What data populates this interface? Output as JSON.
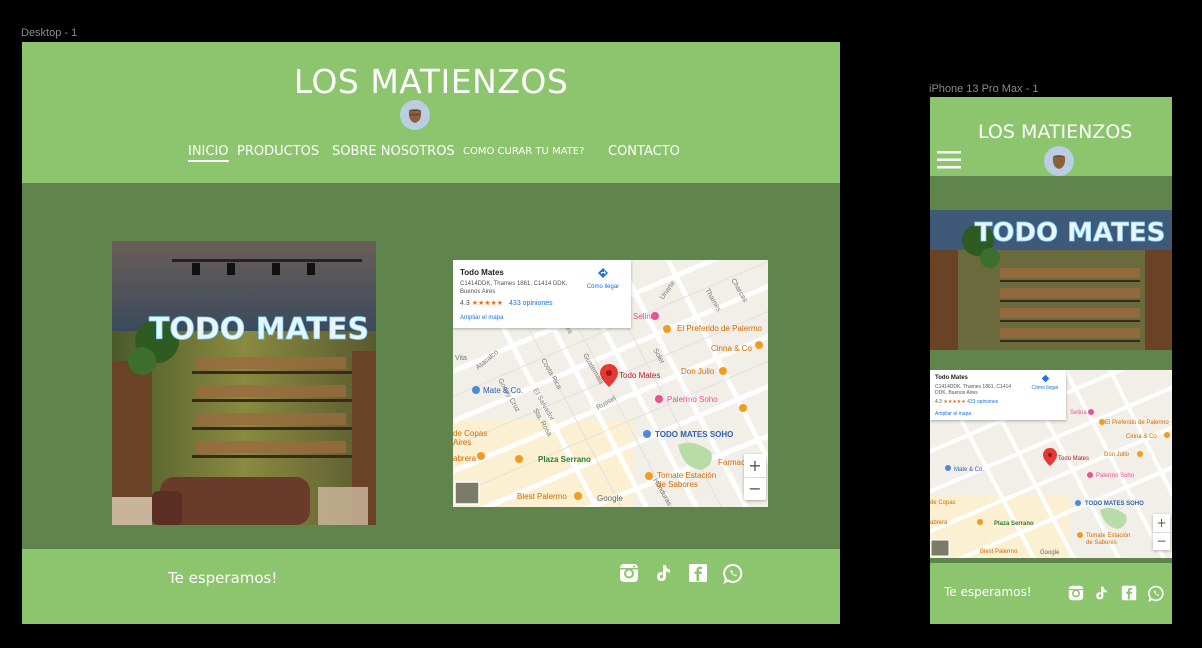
{
  "frames": {
    "desktop_label": "Desktop - 1",
    "mobile_label": "iPhone 13 Pro Max - 1"
  },
  "site": {
    "title": "LOS MATIENZOS",
    "nav": [
      {
        "label": "INICIO",
        "active": true
      },
      {
        "label": "PRODUCTOS",
        "active": false
      },
      {
        "label": "SOBRE NOSOTROS",
        "active": false
      },
      {
        "label": "COMO CURAR TU MATE?",
        "active": false
      },
      {
        "label": "CONTACTO",
        "active": false
      }
    ],
    "store_sign": "TODO MATES",
    "footer_text": "Te esperamos!",
    "social_icons": [
      "instagram-icon",
      "tiktok-icon",
      "facebook-icon",
      "whatsapp-icon"
    ]
  },
  "map": {
    "place_name": "Todo Mates",
    "address": "C1414DDK, Thames 1861, C1414 DDK, Buenos Aires",
    "rating": "4.3",
    "stars": "★★★★★",
    "reviews": "433 opiniones",
    "directions": "Cómo llegar",
    "enlarge": "Ampliar el mapa",
    "zoom_in": "+",
    "zoom_out": "−",
    "brand": "Google",
    "pois": [
      "Selina",
      "El Preferido de Palermo",
      "Cinna & Co",
      "Todo Mates",
      "Don Julio",
      "Mate & Co.",
      "Palermo Soho",
      "TODO MATES SOHO",
      "Plaza Serrano",
      "Farmac",
      "Tomate Estación de Sabores",
      "Blest Palermo",
      "de Copas Aires",
      "abrera"
    ],
    "streets": [
      "Uriarte",
      "Thames",
      "Charcas",
      "Costa Rica",
      "Guatemala",
      "Soler",
      "Gorriti",
      "El Salvador",
      "Godoy Cruz",
      "Russel",
      "Sta. Rosa",
      "Honduras",
      "Atacalco",
      "Borges",
      "Vita"
    ]
  },
  "colors": {
    "header_green": "#8cc56e",
    "body_green": "#5f854c",
    "text_white": "#ffffff"
  }
}
